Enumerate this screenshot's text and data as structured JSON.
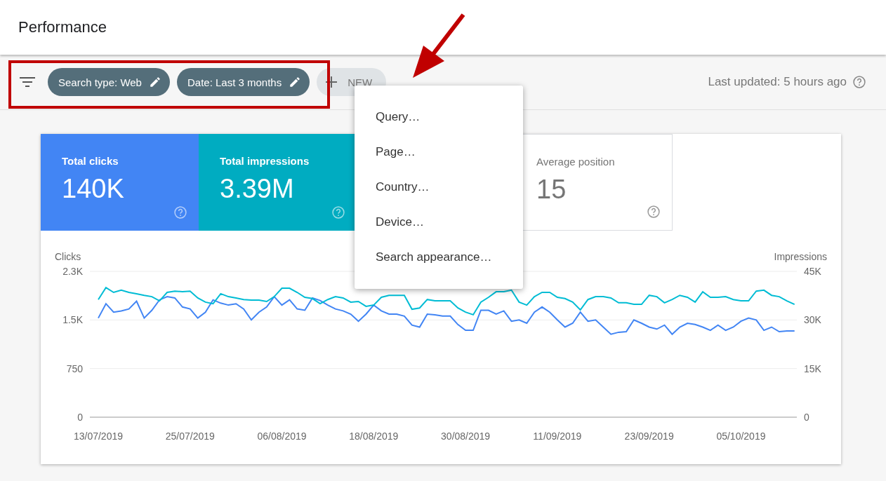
{
  "header": {
    "title": "Performance"
  },
  "filter_bar": {
    "chips": [
      {
        "label": "Search type: Web",
        "kind": "filter"
      },
      {
        "label": "Date: Last 3 months",
        "kind": "filter"
      },
      {
        "label": "NEW",
        "kind": "add"
      }
    ],
    "last_updated": "Last updated: 5 hours ago"
  },
  "metrics": [
    {
      "label": "Total clicks",
      "value": "140K",
      "selected": true,
      "color": "#4285f4"
    },
    {
      "label": "Total impressions",
      "value": "3.39M",
      "selected": true,
      "color": "#00acc1"
    },
    {
      "label": "Average position",
      "value": "15",
      "selected": false
    }
  ],
  "chart": {
    "chart_data": {
      "type": "line",
      "categories": [
        "13/07/2019",
        null,
        null,
        null,
        null,
        null,
        null,
        null,
        null,
        null,
        null,
        null,
        "25/07/2019",
        null,
        null,
        null,
        null,
        null,
        null,
        null,
        null,
        null,
        null,
        null,
        "06/08/2019",
        null,
        null,
        null,
        null,
        null,
        null,
        null,
        null,
        null,
        null,
        null,
        "18/08/2019",
        null,
        null,
        null,
        null,
        null,
        null,
        null,
        null,
        null,
        null,
        null,
        "30/08/2019",
        null,
        null,
        null,
        null,
        null,
        null,
        null,
        null,
        null,
        null,
        null,
        "11/09/2019",
        null,
        null,
        null,
        null,
        null,
        null,
        null,
        null,
        null,
        null,
        null,
        "23/09/2019",
        null,
        null,
        null,
        null,
        null,
        null,
        null,
        null,
        null,
        null,
        null,
        "05/10/2019",
        null,
        null,
        null,
        null,
        null,
        null,
        null
      ],
      "ylim": [
        0,
        2250
      ],
      "yticks": [
        {
          "value": 0,
          "label": "0"
        },
        {
          "value": 750,
          "label": "750"
        },
        {
          "value": 1500,
          "label": "1.5K"
        },
        {
          "value": 2250,
          "label": "2.3K"
        }
      ],
      "y2lim": [
        0,
        45000
      ],
      "y2ticks": [
        {
          "value": 0,
          "label": "0"
        },
        {
          "value": 15000,
          "label": "15K"
        },
        {
          "value": 30000,
          "label": "30K"
        },
        {
          "value": 45000,
          "label": "45K"
        }
      ],
      "ylabel": "Clicks",
      "y2label": "Impressions",
      "series": [
        {
          "color": "#4285f4",
          "values": [
            1530,
            1750,
            1620,
            1640,
            1670,
            1790,
            1530,
            1650,
            1810,
            1860,
            1840,
            1700,
            1670,
            1530,
            1620,
            1810,
            1760,
            1730,
            1750,
            1670,
            1500,
            1620,
            1700,
            1860,
            1730,
            1810,
            1670,
            1650,
            1840,
            1800,
            1730,
            1670,
            1640,
            1590,
            1480,
            1590,
            1730,
            1640,
            1590,
            1590,
            1560,
            1420,
            1390,
            1590,
            1580,
            1560,
            1560,
            1430,
            1340,
            1340,
            1650,
            1650,
            1590,
            1640,
            1480,
            1500,
            1450,
            1620,
            1700,
            1620,
            1500,
            1390,
            1450,
            1620,
            1480,
            1500,
            1390,
            1280,
            1310,
            1320,
            1500,
            1450,
            1390,
            1360,
            1420,
            1280,
            1390,
            1450,
            1430,
            1390,
            1340,
            1420,
            1340,
            1390,
            1480,
            1530,
            1500,
            1340,
            1390,
            1320,
            1330,
            1330
          ]
        },
        {
          "color": "#00bcd4",
          "axis": "y2",
          "values": [
            36300,
            40000,
            38500,
            39200,
            38500,
            38100,
            37600,
            37200,
            35900,
            38500,
            38900,
            38700,
            38900,
            36800,
            35500,
            35000,
            38100,
            37200,
            36800,
            36300,
            36100,
            36100,
            35700,
            37200,
            39800,
            39800,
            38500,
            37000,
            36600,
            35000,
            36300,
            37200,
            36800,
            35500,
            35700,
            34200,
            34600,
            37000,
            37600,
            37600,
            37600,
            33300,
            33700,
            36300,
            35900,
            35900,
            35900,
            33700,
            32400,
            31600,
            35500,
            37000,
            38700,
            38700,
            39200,
            35500,
            34600,
            37200,
            38500,
            38500,
            37000,
            36600,
            35500,
            33100,
            36300,
            37200,
            37200,
            36800,
            35300,
            35300,
            34800,
            34800,
            37600,
            37200,
            35300,
            36300,
            37600,
            37000,
            35500,
            38700,
            37000,
            37000,
            37200,
            36300,
            35900,
            35900,
            38900,
            39200,
            37600,
            37200,
            35900,
            34800
          ]
        }
      ]
    }
  },
  "menu": {
    "items": [
      "Query…",
      "Page…",
      "Country…",
      "Device…",
      "Search appearance…"
    ]
  }
}
